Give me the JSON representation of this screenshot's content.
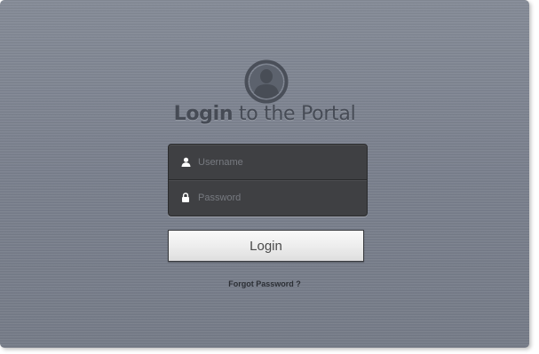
{
  "header": {
    "title_bold": "Login",
    "title_rest": " to the Portal",
    "avatar_icon": "user-avatar-icon"
  },
  "form": {
    "username": {
      "placeholder": "Username",
      "value": "",
      "icon": "user-icon"
    },
    "password": {
      "placeholder": "Password",
      "value": "",
      "icon": "lock-icon"
    },
    "login_label": "Login",
    "forgot_label": "Forgot Password ?"
  },
  "colors": {
    "background": "#7c8390",
    "title": "#464b55",
    "field_bg": "#3f4043",
    "button_bg": "#ececec"
  }
}
